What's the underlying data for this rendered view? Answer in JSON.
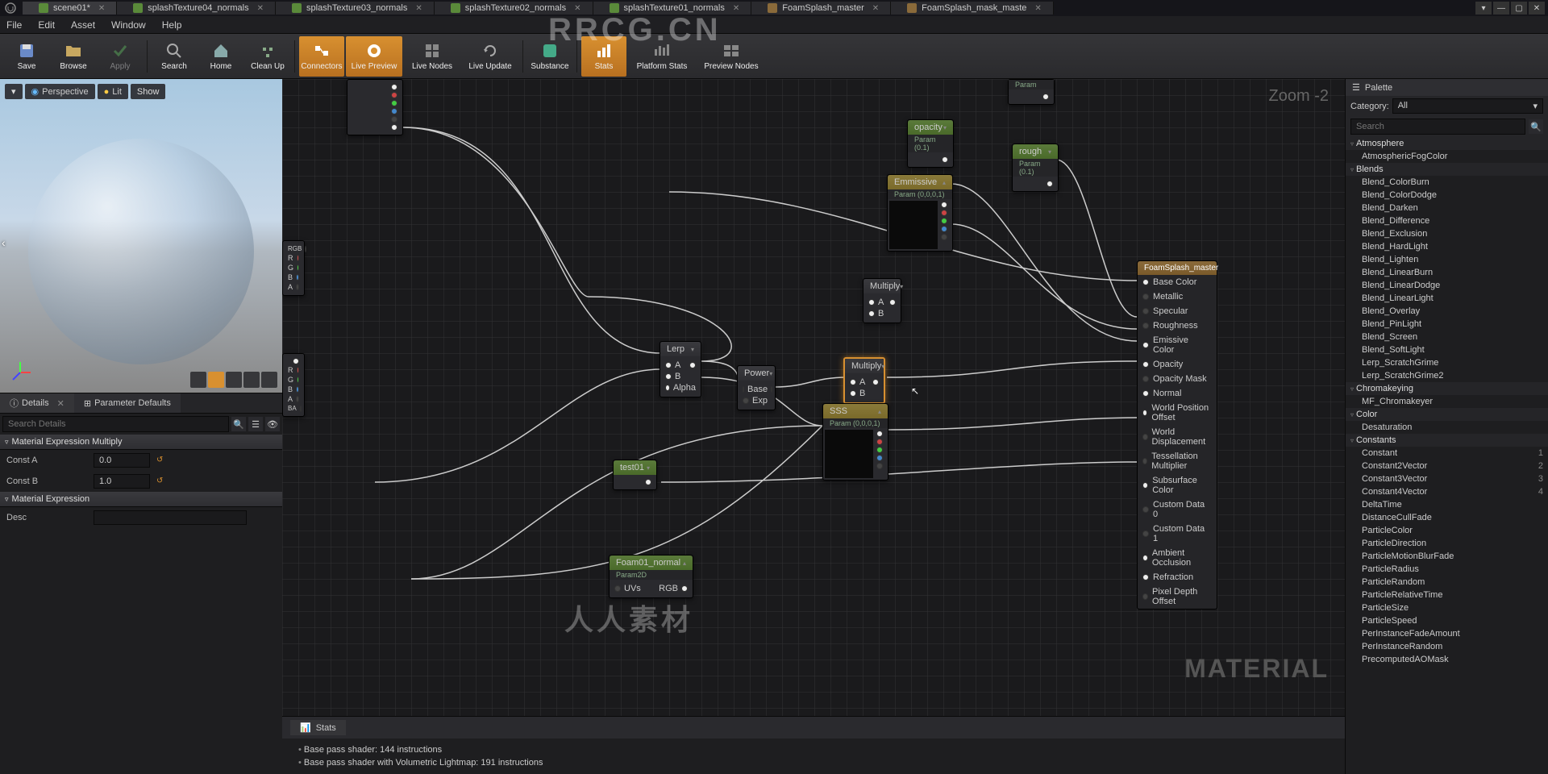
{
  "tabs": [
    {
      "label": "scene01*",
      "active": true
    },
    {
      "label": "splashTexture04_normals"
    },
    {
      "label": "splashTexture03_normals"
    },
    {
      "label": "splashTexture02_normals"
    },
    {
      "label": "splashTexture01_normals"
    },
    {
      "label": "FoamSplash_master",
      "blue": true
    },
    {
      "label": "FoamSplash_mask_maste",
      "blue": true
    }
  ],
  "menu": {
    "file": "File",
    "edit": "Edit",
    "asset": "Asset",
    "window": "Window",
    "help": "Help"
  },
  "toolbar": {
    "save": "Save",
    "browse": "Browse",
    "apply": "Apply",
    "search": "Search",
    "home": "Home",
    "cleanup": "Clean Up",
    "connectors": "Connectors",
    "livepreview": "Live Preview",
    "livenodes": "Live Nodes",
    "liveupdate": "Live Update",
    "substance": "Substance",
    "stats": "Stats",
    "platformstats": "Platform Stats",
    "previewnodes": "Preview Nodes"
  },
  "viewport": {
    "perspective": "Perspective",
    "lit": "Lit",
    "show": "Show"
  },
  "details": {
    "tab1": "Details",
    "tab2": "Parameter Defaults",
    "search_placeholder": "Search Details",
    "section1": "Material Expression Multiply",
    "constA_label": "Const A",
    "constA_value": "0.0",
    "constB_label": "Const B",
    "constB_value": "1.0",
    "section2": "Material Expression",
    "desc_label": "Desc",
    "desc_value": ""
  },
  "graph": {
    "zoom": "Zoom -2",
    "material_label": "MATERIAL",
    "nodes": {
      "opacity": {
        "title": "opacity",
        "sub": "Param (0.1)"
      },
      "rough": {
        "title": "rough",
        "sub": "Param (0.1)"
      },
      "emissive": {
        "title": "Emmissive",
        "sub": "Param (0,0,0,1)"
      },
      "multiply1": {
        "title": "Multiply",
        "pinA": "A",
        "pinB": "B"
      },
      "multiply2": {
        "title": "Multiply",
        "pinA": "A",
        "pinB": "B"
      },
      "lerp": {
        "title": "Lerp",
        "pinA": "A",
        "pinB": "B",
        "pinAlpha": "Alpha"
      },
      "power": {
        "title": "Power",
        "pinBase": "Base",
        "pinExp": "Exp"
      },
      "sss": {
        "title": "SSS",
        "sub": "Param (0,0,0,1)"
      },
      "test01": {
        "title": "test01"
      },
      "foam01": {
        "title": "Foam01_normal",
        "sub": "Param2D",
        "uvs": "UVs",
        "rgb": "RGB"
      },
      "output": {
        "title": "FoamSplash_master",
        "pins": [
          "Base Color",
          "Metallic",
          "Specular",
          "Roughness",
          "Emissive Color",
          "Opacity",
          "Opacity Mask",
          "Normal",
          "World Position Offset",
          "World Displacement",
          "Tessellation Multiplier",
          "Subsurface Color",
          "Custom Data 0",
          "Custom Data 1",
          "Ambient Occlusion",
          "Refraction",
          "Pixel Depth Offset"
        ]
      },
      "rgb_labels": {
        "rgb": "RGB",
        "r": "R",
        "g": "G",
        "b": "B",
        "a": "A",
        "rgba": "RGBA"
      }
    }
  },
  "stats": {
    "tab": "Stats",
    "line1": "Base pass shader: 144 instructions",
    "line2": "Base pass shader with Volumetric Lightmap: 191 instructions"
  },
  "palette": {
    "title": "Palette",
    "category_label": "Category:",
    "category_value": "All",
    "search_placeholder": "Search",
    "groups": [
      {
        "name": "Atmosphere",
        "items": [
          {
            "n": "AtmosphericFogColor"
          }
        ]
      },
      {
        "name": "Blends",
        "items": [
          {
            "n": "Blend_ColorBurn"
          },
          {
            "n": "Blend_ColorDodge"
          },
          {
            "n": "Blend_Darken"
          },
          {
            "n": "Blend_Difference"
          },
          {
            "n": "Blend_Exclusion"
          },
          {
            "n": "Blend_HardLight"
          },
          {
            "n": "Blend_Lighten"
          },
          {
            "n": "Blend_LinearBurn"
          },
          {
            "n": "Blend_LinearDodge"
          },
          {
            "n": "Blend_LinearLight"
          },
          {
            "n": "Blend_Overlay"
          },
          {
            "n": "Blend_PinLight"
          },
          {
            "n": "Blend_Screen"
          },
          {
            "n": "Blend_SoftLight"
          },
          {
            "n": "Lerp_ScratchGrime"
          },
          {
            "n": "Lerp_ScratchGrime2"
          }
        ]
      },
      {
        "name": "Chromakeying",
        "items": [
          {
            "n": "MF_Chromakeyer"
          }
        ]
      },
      {
        "name": "Color",
        "items": [
          {
            "n": "Desaturation"
          }
        ]
      },
      {
        "name": "Constants",
        "items": [
          {
            "n": "Constant",
            "k": "1"
          },
          {
            "n": "Constant2Vector",
            "k": "2"
          },
          {
            "n": "Constant3Vector",
            "k": "3"
          },
          {
            "n": "Constant4Vector",
            "k": "4"
          },
          {
            "n": "DeltaTime"
          },
          {
            "n": "DistanceCullFade"
          },
          {
            "n": "ParticleColor"
          },
          {
            "n": "ParticleDirection"
          },
          {
            "n": "ParticleMotionBlurFade"
          },
          {
            "n": "ParticleRadius"
          },
          {
            "n": "ParticleRandom"
          },
          {
            "n": "ParticleRelativeTime"
          },
          {
            "n": "ParticleSize"
          },
          {
            "n": "ParticleSpeed"
          },
          {
            "n": "PerInstanceFadeAmount"
          },
          {
            "n": "PerInstanceRandom"
          },
          {
            "n": "PrecomputedAOMask"
          }
        ]
      }
    ]
  },
  "watermark": "RRCG.CN",
  "watermark2": "人人素材"
}
